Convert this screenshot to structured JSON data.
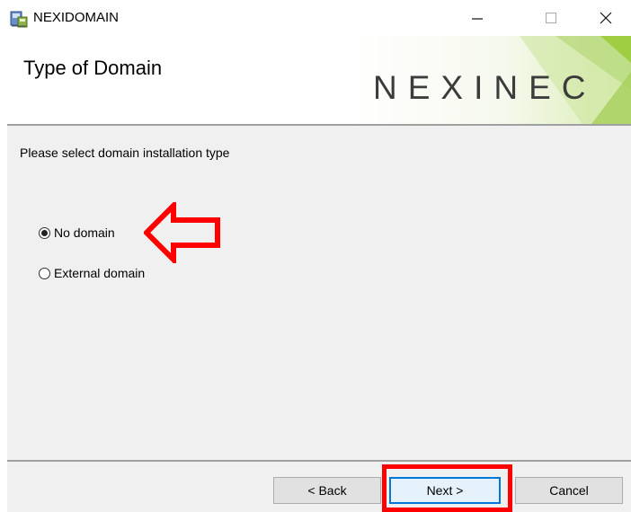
{
  "window": {
    "title": "NEXIDOMAIN",
    "icons": {
      "app": "installer-icon",
      "minimize": "minimize-icon",
      "maximize": "maximize-icon",
      "close": "close-icon"
    }
  },
  "header": {
    "title": "Type of Domain",
    "brand": "NEXINEC",
    "brand_accent_color": "#9ccc3c"
  },
  "body": {
    "instruction": "Please select domain installation type",
    "options": [
      {
        "label": "No domain",
        "selected": true
      },
      {
        "label": "External domain",
        "selected": false
      }
    ],
    "highlight_color": "#ff0000"
  },
  "footer": {
    "back_label": "< Back",
    "next_label": "Next >",
    "cancel_label": "Cancel"
  }
}
